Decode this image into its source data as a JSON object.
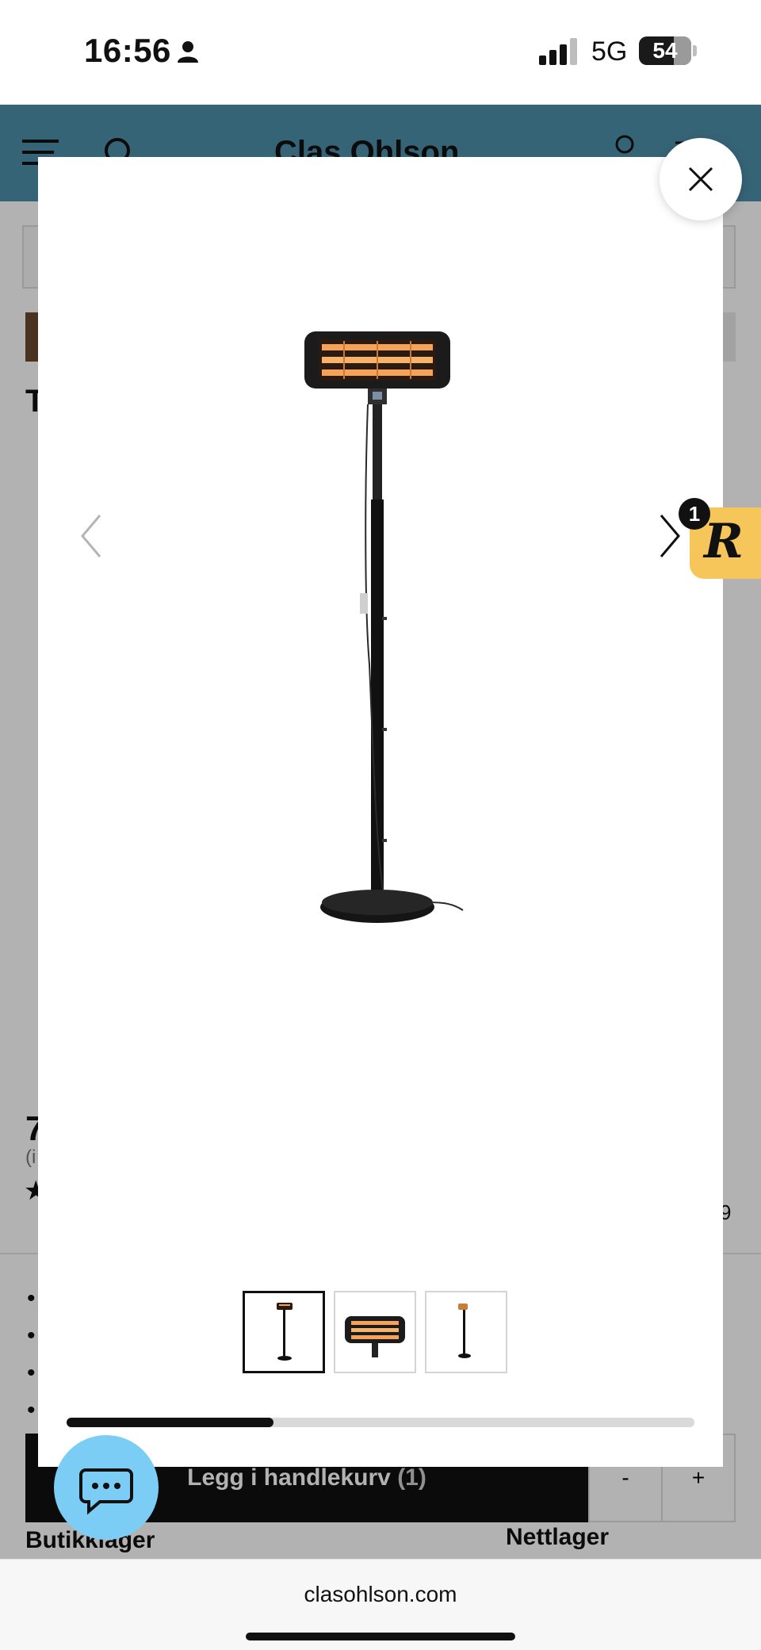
{
  "status_bar": {
    "time": "16:56",
    "network": "5G",
    "battery": "54"
  },
  "background_page": {
    "brand": "Clas Ohlson",
    "title_fragment": "T",
    "price_fragment": "7",
    "price_note_fragment": "(i",
    "rating_count_fragment": "9",
    "add_to_cart_label": "Legg i handlekurv",
    "add_to_cart_count": "(1)",
    "qty_minus": "-",
    "qty_plus": "+",
    "store_stock": "Butikklager",
    "web_stock": "Nettlager"
  },
  "gallery": {
    "image_name": "patio heater on stand",
    "thumbnails": [
      {
        "name": "full-heater",
        "active": true
      },
      {
        "name": "heater-head-closeup",
        "active": false
      },
      {
        "name": "heater-side-view",
        "active": false
      }
    ],
    "progress": 0.33
  },
  "rewards_badge": {
    "count": "1",
    "letter": "R"
  },
  "browser": {
    "url": "clasohlson.com"
  }
}
